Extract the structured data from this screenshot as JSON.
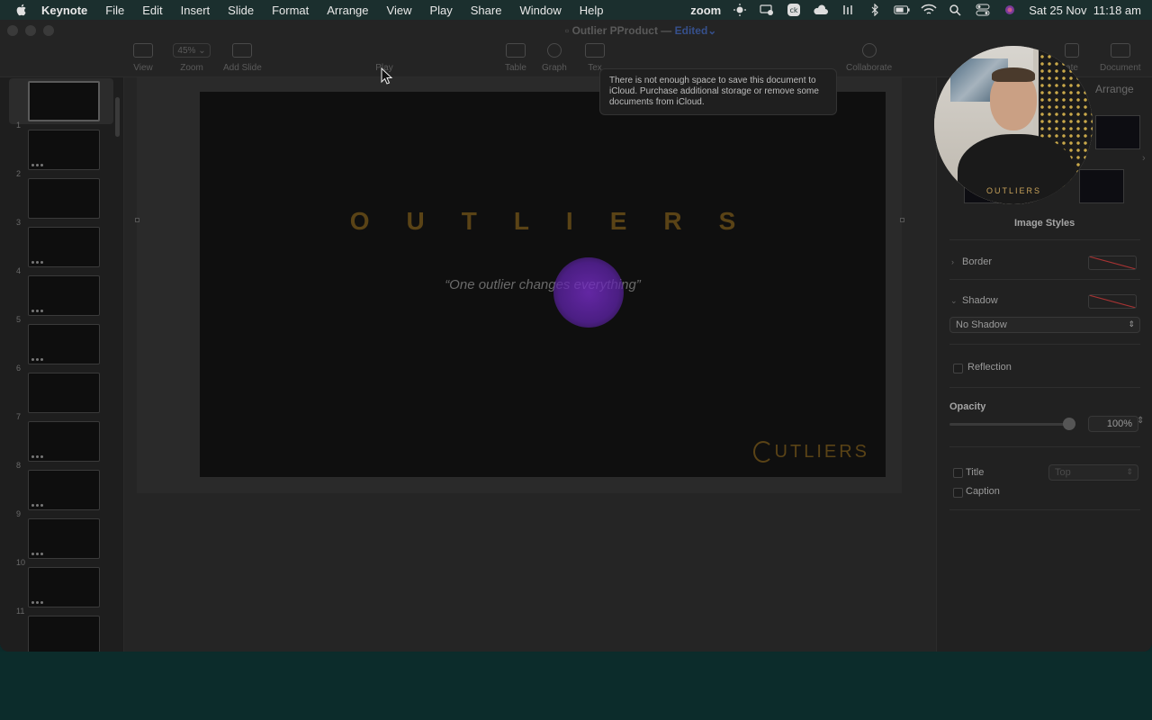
{
  "menubar": {
    "app_name": "Keynote",
    "menus": [
      "File",
      "Edit",
      "Insert",
      "Slide",
      "Format",
      "Arrange",
      "View",
      "Play",
      "Share",
      "Window",
      "Help"
    ],
    "zoom_label": "zoom",
    "datetime": "Sat 25 Nov  11:18 am"
  },
  "window": {
    "doc_title": "Outlier PProduct",
    "doc_status": "Edited"
  },
  "toolbar": {
    "view_label": "View",
    "zoom_value": "45%",
    "zoom_label": "Zoom",
    "add_slide_label": "Add Slide",
    "play_label": "Play",
    "table_label": "Table",
    "graph_label": "Graph",
    "text_label": "Tex",
    "collaborate_label": "Collaborate",
    "animate_label": "ate",
    "document_label": "Document"
  },
  "notice": {
    "text": "There is not enough space to save this document to iCloud. Purchase additional storage or remove some documents from iCloud."
  },
  "navigator": {
    "slides": [
      "1",
      "2",
      "3",
      "4",
      "5",
      "6",
      "7",
      "8",
      "9",
      "10",
      "11"
    ],
    "selected": "1"
  },
  "slide": {
    "title": "OUTLIERS",
    "tagline": "“One outlier changes everything”",
    "brand": "UTLIERS",
    "title_color": "#c58a1e",
    "background": "#0f0f0f"
  },
  "inspector": {
    "tab_arrange": "Arrange",
    "image_styles_label": "Image Styles",
    "border_label": "Border",
    "shadow_label": "Shadow",
    "shadow_value": "No Shadow",
    "reflection_label": "Reflection",
    "opacity_label": "Opacity",
    "opacity_value": "100%",
    "opacity_fraction": 1.0,
    "title_label": "Title",
    "title_position": "Top",
    "caption_label": "Caption"
  },
  "webcam": {
    "shirt_text": "OUTLIERS"
  }
}
